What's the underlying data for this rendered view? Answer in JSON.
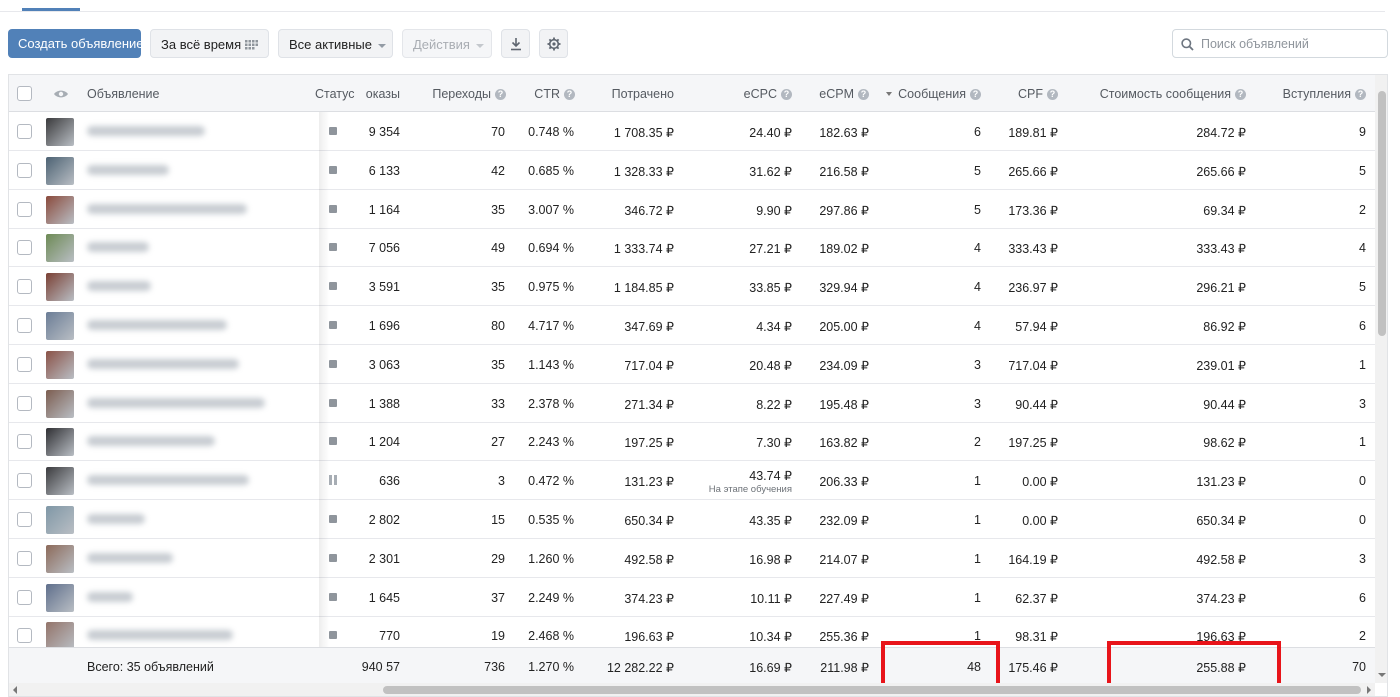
{
  "toolbar": {
    "create_label": "Создать объявление",
    "period_label": "За всё время",
    "filter_label": "Все активные",
    "actions_label": "Действия",
    "search_placeholder": "Поиск объявлений",
    "search_value": ""
  },
  "columns": {
    "ad": "Объявление",
    "status": "Статус",
    "impressions": "оказы",
    "clicks": "Переходы",
    "ctr": "CTR",
    "spent": "Потрачено",
    "ecpc": "eCPC",
    "ecpm": "eCPM",
    "messages": "Сообщения",
    "cpf": "CPF",
    "msg_cost": "Стоимость сообщения",
    "joins": "Вступления"
  },
  "rows": [
    {
      "status": "stopped",
      "impressions": "9 354",
      "clicks": "70",
      "ctr": "0.748 %",
      "spent": "1 708.35 ₽",
      "ecpc": "24.40 ₽",
      "ecpm": "182.63 ₽",
      "messages": "6",
      "cpf": "189.81 ₽",
      "msg_cost": "284.72 ₽",
      "joins": "9",
      "thumb": "#3a3a3c"
    },
    {
      "status": "stopped",
      "impressions": "6 133",
      "clicks": "42",
      "ctr": "0.685 %",
      "spent": "1 328.33 ₽",
      "ecpc": "31.62 ₽",
      "ecpm": "216.58 ₽",
      "messages": "5",
      "cpf": "265.66 ₽",
      "msg_cost": "265.66 ₽",
      "joins": "5",
      "thumb": "#4c6273"
    },
    {
      "status": "stopped",
      "impressions": "1 164",
      "clicks": "35",
      "ctr": "3.007 %",
      "spent": "346.72 ₽",
      "ecpc": "9.90 ₽",
      "ecpm": "297.86 ₽",
      "messages": "5",
      "cpf": "173.36 ₽",
      "msg_cost": "69.34 ₽",
      "joins": "2",
      "thumb": "#8a4a3c"
    },
    {
      "status": "stopped",
      "impressions": "7 056",
      "clicks": "49",
      "ctr": "0.694 %",
      "spent": "1 333.74 ₽",
      "ecpc": "27.21 ₽",
      "ecpm": "189.02 ₽",
      "messages": "4",
      "cpf": "333.43 ₽",
      "msg_cost": "333.43 ₽",
      "joins": "4",
      "thumb": "#6d8a55"
    },
    {
      "status": "stopped",
      "impressions": "3 591",
      "clicks": "35",
      "ctr": "0.975 %",
      "spent": "1 184.85 ₽",
      "ecpc": "33.85 ₽",
      "ecpm": "329.94 ₽",
      "messages": "4",
      "cpf": "236.97 ₽",
      "msg_cost": "296.21 ₽",
      "joins": "5",
      "thumb": "#7a4034"
    },
    {
      "status": "stopped",
      "impressions": "1 696",
      "clicks": "80",
      "ctr": "4.717 %",
      "spent": "347.69 ₽",
      "ecpc": "4.34 ₽",
      "ecpm": "205.00 ₽",
      "messages": "4",
      "cpf": "57.94 ₽",
      "msg_cost": "86.92 ₽",
      "joins": "6",
      "thumb": "#6b7d96"
    },
    {
      "status": "stopped",
      "impressions": "3 063",
      "clicks": "35",
      "ctr": "1.143 %",
      "spent": "717.04 ₽",
      "ecpc": "20.48 ₽",
      "ecpm": "234.09 ₽",
      "messages": "3",
      "cpf": "717.04 ₽",
      "msg_cost": "239.01 ₽",
      "joins": "1",
      "thumb": "#8a5247"
    },
    {
      "status": "stopped",
      "impressions": "1 388",
      "clicks": "33",
      "ctr": "2.378 %",
      "spent": "271.34 ₽",
      "ecpc": "8.22 ₽",
      "ecpm": "195.48 ₽",
      "messages": "3",
      "cpf": "90.44 ₽",
      "msg_cost": "90.44 ₽",
      "joins": "3",
      "thumb": "#7c5d50"
    },
    {
      "status": "stopped",
      "impressions": "1 204",
      "clicks": "27",
      "ctr": "2.243 %",
      "spent": "197.25 ₽",
      "ecpc": "7.30 ₽",
      "ecpm": "163.82 ₽",
      "messages": "2",
      "cpf": "197.25 ₽",
      "msg_cost": "98.62 ₽",
      "joins": "1",
      "thumb": "#2f2f33"
    },
    {
      "status": "paused",
      "impressions": "636",
      "clicks": "3",
      "ctr": "0.472 %",
      "spent": "131.23 ₽",
      "ecpc": "43.74 ₽",
      "ecpc_note": "На этапе обучения",
      "ecpm": "206.33 ₽",
      "messages": "1",
      "cpf": "0.00 ₽",
      "msg_cost": "131.23 ₽",
      "joins": "0",
      "thumb": "#3b3b3e"
    },
    {
      "status": "stopped",
      "impressions": "2 802",
      "clicks": "15",
      "ctr": "0.535 %",
      "spent": "650.34 ₽",
      "ecpc": "43.35 ₽",
      "ecpm": "232.09 ₽",
      "messages": "1",
      "cpf": "0.00 ₽",
      "msg_cost": "650.34 ₽",
      "joins": "0",
      "thumb": "#7f97a6"
    },
    {
      "status": "stopped",
      "impressions": "2 301",
      "clicks": "29",
      "ctr": "1.260 %",
      "spent": "492.58 ₽",
      "ecpc": "16.98 ₽",
      "ecpm": "214.07 ₽",
      "messages": "1",
      "cpf": "164.19 ₽",
      "msg_cost": "492.58 ₽",
      "joins": "3",
      "thumb": "#8c6a5a"
    },
    {
      "status": "stopped",
      "impressions": "1 645",
      "clicks": "37",
      "ctr": "2.249 %",
      "spent": "374.23 ₽",
      "ecpc": "10.11 ₽",
      "ecpm": "227.49 ₽",
      "messages": "1",
      "cpf": "62.37 ₽",
      "msg_cost": "374.23 ₽",
      "joins": "6",
      "thumb": "#5f6f8c"
    },
    {
      "status": "stopped",
      "impressions": "770",
      "clicks": "19",
      "ctr": "2.468 %",
      "spent": "196.63 ₽",
      "ecpc": "10.34 ₽",
      "ecpm": "255.36 ₽",
      "messages": "1",
      "cpf": "98.31 ₽",
      "msg_cost": "196.63 ₽",
      "joins": "2",
      "thumb": "#93746a"
    }
  ],
  "totals": {
    "label": "Всего: 35 объявлений",
    "impressions": "57 940",
    "clicks": "736",
    "ctr": "1.270 %",
    "spent": "12 282.22 ₽",
    "ecpc": "16.69 ₽",
    "ecpm": "211.98 ₽",
    "messages": "48",
    "cpf": "175.46 ₽",
    "msg_cost": "255.88 ₽",
    "joins": "70"
  },
  "colors": {
    "primary": "#5181b8",
    "highlight": "#e8141a"
  }
}
